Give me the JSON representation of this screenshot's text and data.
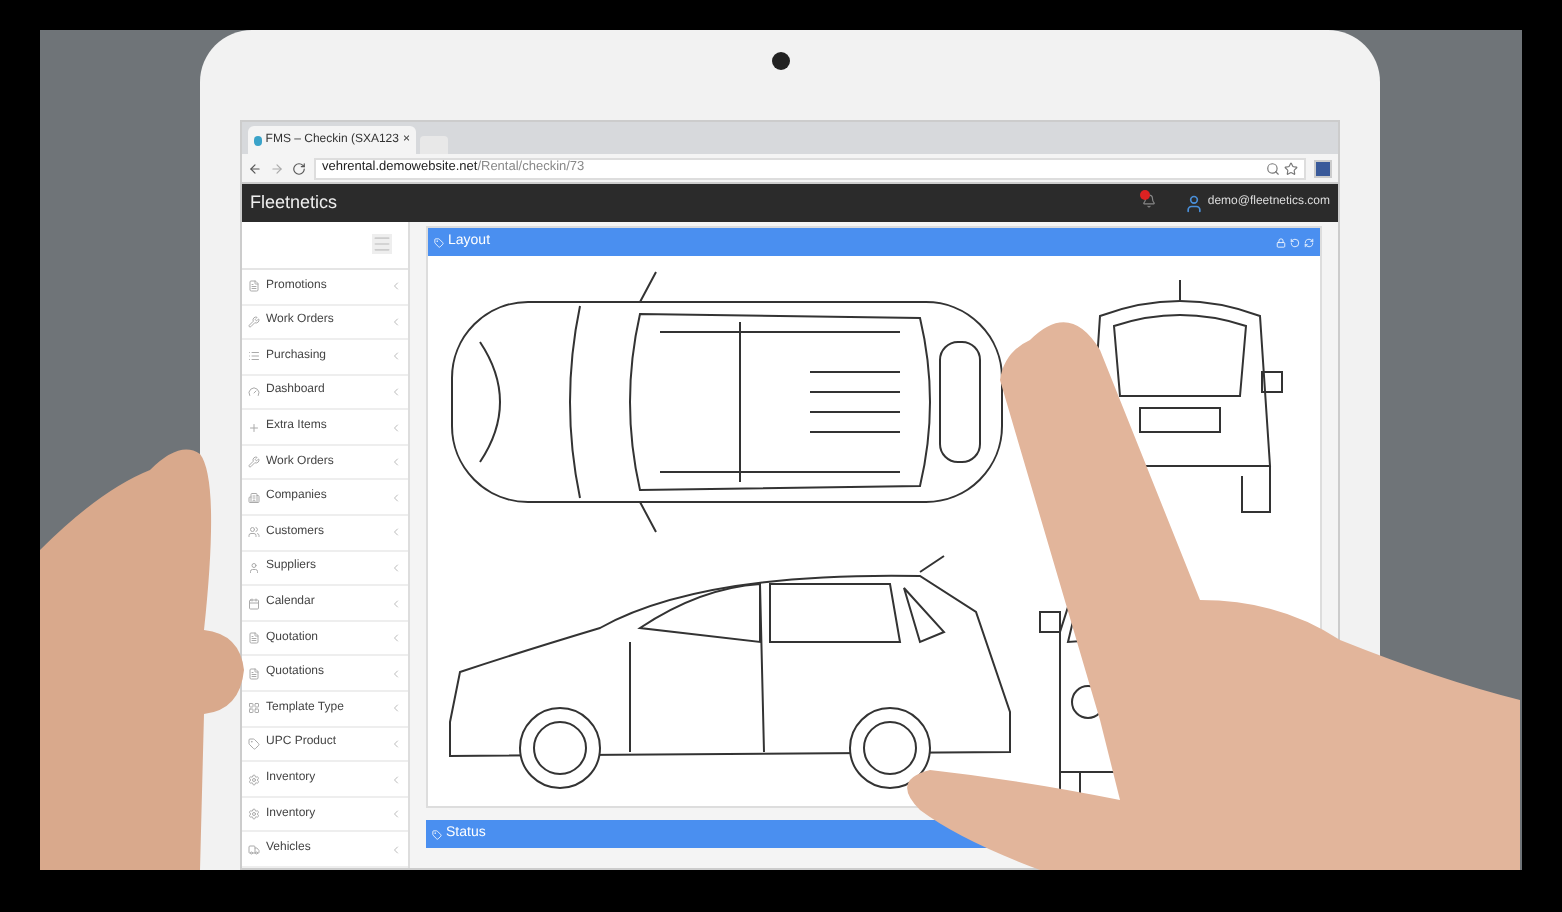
{
  "browser": {
    "tab_title": "FMS – Checkin (SXA123",
    "tab_close": "×",
    "url_host": "vehrental.demowebsite.net",
    "url_path": "/Rental/checkin/73"
  },
  "app": {
    "brand": "Fleetnetics",
    "user": "demo@fleetnetics.com"
  },
  "sidebar": {
    "items": [
      {
        "label": "Promotions"
      },
      {
        "label": "Work Orders"
      },
      {
        "label": "Purchasing"
      },
      {
        "label": "Dashboard"
      },
      {
        "label": "Extra Items"
      },
      {
        "label": "Work Orders"
      },
      {
        "label": "Companies"
      },
      {
        "label": "Customers"
      },
      {
        "label": "Suppliers"
      },
      {
        "label": "Calendar"
      },
      {
        "label": "Quotation"
      },
      {
        "label": "Quotations"
      },
      {
        "label": "Template Type"
      },
      {
        "label": "UPC Product"
      },
      {
        "label": "Inventory"
      },
      {
        "label": "Inventory"
      },
      {
        "label": "Vehicles"
      }
    ]
  },
  "panels": [
    {
      "title": "Layout"
    },
    {
      "title": "Status"
    }
  ]
}
